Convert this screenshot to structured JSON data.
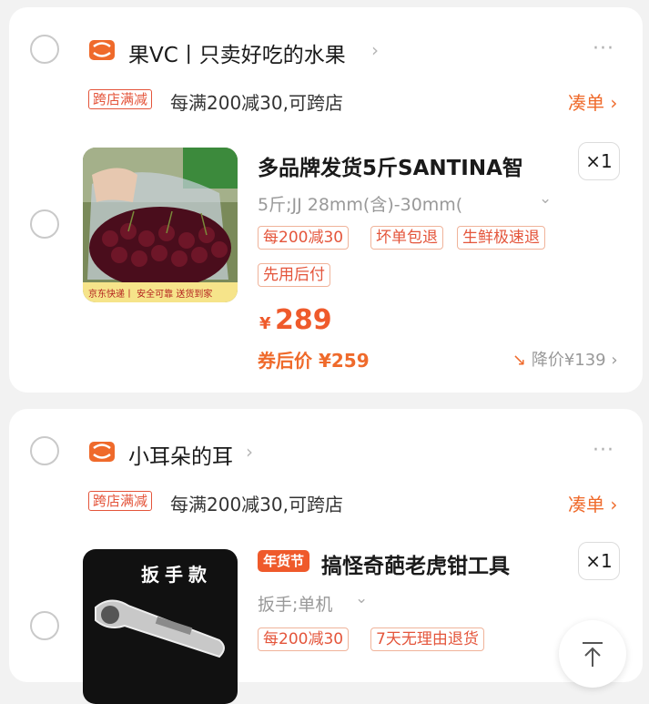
{
  "colors": {
    "accent": "#ef5a2b",
    "tag_red": "#e4553b",
    "muted": "#999999"
  },
  "cart": [
    {
      "shop_name": "果VC丨只卖好吃的水果",
      "promo_tag": "跨店满减",
      "promo_text": "每满200减30,可跨店",
      "add_on_label": "凑单 ›",
      "item": {
        "title": "多品牌发货5斤SANTINA智",
        "quantity": "×1",
        "spec": "5斤;JJ 28mm(含)-30mm(",
        "chips": [
          "每200减30",
          "坏单包退",
          "生鲜极速退",
          "先用后付"
        ],
        "currency": "¥",
        "price": "289",
        "coupon_price": "券后价 ¥259",
        "price_drop": "降价¥139",
        "thumb_caption": "京东快递丨 安全可靠 送货到家"
      }
    },
    {
      "shop_name": "小耳朵的耳",
      "promo_tag": "跨店满减",
      "promo_text": "每满200减30,可跨店",
      "add_on_label": "凑单 ›",
      "item": {
        "badge": "年货节",
        "title": "搞怪奇葩老虎钳工具",
        "quantity": "×1",
        "spec": "扳手;单机",
        "chips": [
          "每200减30",
          "7天无理由退货"
        ],
        "thumb_caption": "扳手款"
      }
    }
  ],
  "icons": {
    "shop": "shop-icon",
    "more": "more-icon",
    "chevron": "chevron-right-icon",
    "scroll_top": "scroll-to-top-icon"
  }
}
